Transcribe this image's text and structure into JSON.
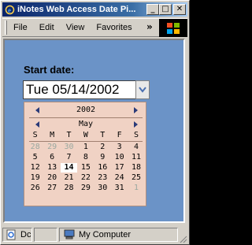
{
  "window": {
    "title": "iNotes Web Access Date Pi...",
    "minimize": "_",
    "maximize": "□",
    "close": "✕"
  },
  "menubar": {
    "items": [
      "File",
      "Edit",
      "View",
      "Favorites"
    ],
    "more": "»"
  },
  "form": {
    "start_label": "Start date:",
    "date_value": "Tue 05/14/2002"
  },
  "calendar": {
    "year": "2002",
    "month": "May",
    "weekdays": [
      "S",
      "M",
      "T",
      "W",
      "T",
      "F",
      "S"
    ],
    "weeks": [
      [
        "28",
        "29",
        "30",
        "1",
        "2",
        "3",
        "4"
      ],
      [
        "5",
        "6",
        "7",
        "8",
        "9",
        "10",
        "11"
      ],
      [
        "12",
        "13",
        "14",
        "15",
        "16",
        "17",
        "18"
      ],
      [
        "19",
        "20",
        "21",
        "22",
        "23",
        "24",
        "25"
      ],
      [
        "26",
        "27",
        "28",
        "29",
        "30",
        "31",
        "1"
      ]
    ],
    "selected": "14"
  },
  "statusbar": {
    "pane1": "Dc",
    "zone": "My Computer"
  },
  "colors": {
    "content_bg": "#6b93c7",
    "calendar_bg": "#f0d2c4",
    "title_start": "#0a246a"
  }
}
